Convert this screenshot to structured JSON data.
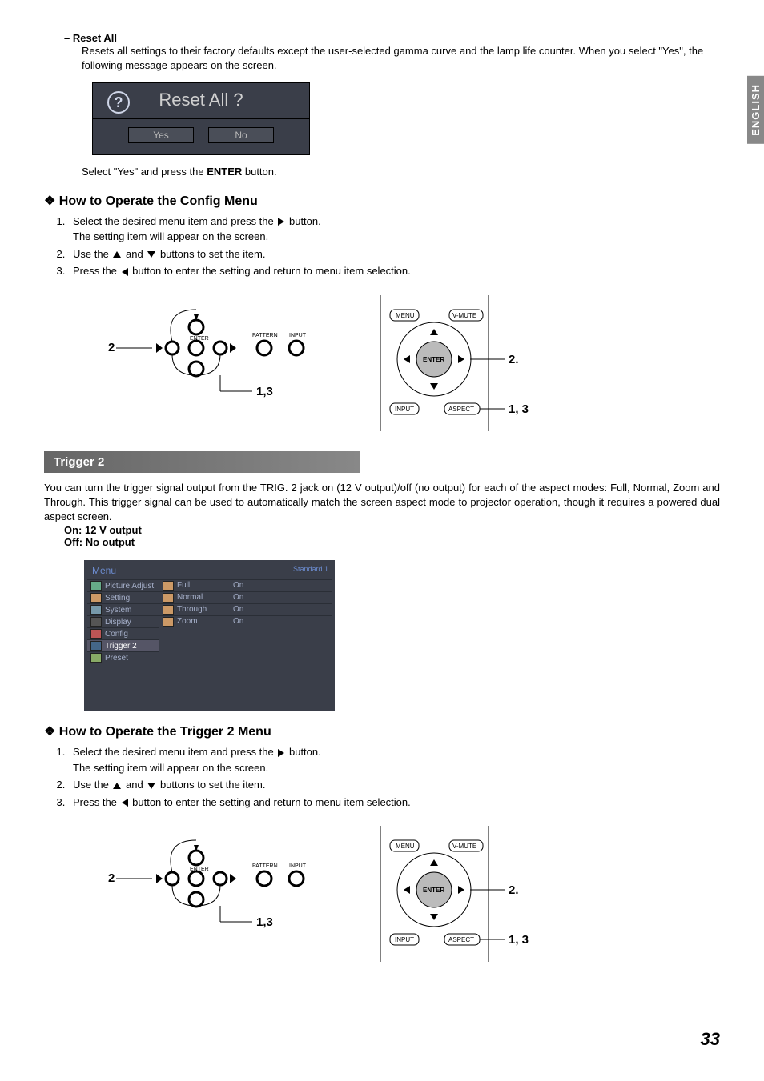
{
  "side_tab": "ENGLISH",
  "reset": {
    "heading": "– Reset All",
    "body": "Resets all settings to their factory defaults except the user-selected gamma curve and the lamp life counter. When you select \"Yes\", the following message appears on the screen.",
    "dialog_title": "Reset All ?",
    "yes": "Yes",
    "no": "No",
    "after": "Select \"Yes\" and press the ",
    "after_b": "ENTER",
    "after2": " button."
  },
  "config": {
    "heading": "How to Operate the Config Menu",
    "s1a": "Select the desired menu item and press the ",
    "s1b": " button.",
    "s1c": "The setting item will appear on the screen.",
    "s2a": "Use the ",
    "s2b": " and ",
    "s2c": " buttons to set the item.",
    "s3a": "Press the ",
    "s3b": " button to enter the setting and return to menu item selection."
  },
  "diagram": {
    "enter": "ENTER",
    "pattern": "PATTERN",
    "input": "INPUT",
    "menu": "MENU",
    "vmute": "V-MUTE",
    "aspect": "ASPECT",
    "l2": "2",
    "l13": "1,3",
    "r2": "2.",
    "r13": "1, 3"
  },
  "trigger": {
    "bar": "Trigger 2",
    "body": "You can turn the trigger signal output from the TRIG. 2 jack on (12 V output)/off (no output) for each of the aspect modes: Full, Normal, Zoom and Through. This trigger signal can be used to automatically match the screen aspect mode to projector operation, though it requires a powered dual aspect screen.",
    "on": "On:  12 V output",
    "off": "Off:  No output"
  },
  "menu": {
    "title": "Menu",
    "mode": "Standard 1",
    "left": [
      "Picture Adjust",
      "Setting",
      "System",
      "Display",
      "Config",
      "Trigger 2",
      "Preset"
    ],
    "right": [
      {
        "l": "Full",
        "v": "On"
      },
      {
        "l": "Normal",
        "v": "On"
      },
      {
        "l": "Through",
        "v": "On"
      },
      {
        "l": "Zoom",
        "v": "On"
      }
    ]
  },
  "trigger_ops": {
    "heading": "How to Operate the Trigger 2 Menu",
    "s1a": "Select the desired menu item and press the ",
    "s1b": " button.",
    "s1c": "The setting item will appear on the screen.",
    "s2a": "Use the ",
    "s2b": " and ",
    "s2c": " buttons to set the item.",
    "s3a": "Press the ",
    "s3b": " button to enter the setting and return to menu item selection."
  },
  "page": "33"
}
